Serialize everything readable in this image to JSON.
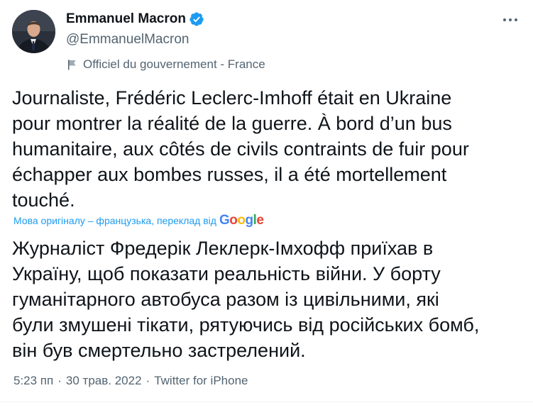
{
  "author": {
    "name": "Emmanuel Macron",
    "handle": "@EmmanuelMacron",
    "verified": true,
    "label": "Officiel du gouvernement - France"
  },
  "tweet": {
    "text": "Journaliste, Frédéric Leclerc-Imhoff était en Ukraine\npour montrer la réalité de la guerre. À bord d’un bus\nhumanitaire, aux côtés de civils contraints de fuir pour\néchapper aux bombes russes, il a été mortellement\ntouché.",
    "translation_note": "Мова оригіналу – французька, переклад від",
    "translation_provider": "Google",
    "translated_text": "Журналіст Фредерік Леклерк-Імхофф приїхав в\nУкраїну, щоб показати реальність війни. У борту\nгуманітарного автобуса разом із цивільними, які\nбули змушені тікати, рятуючись від російських бомб,\nвін був смертельно застрелений."
  },
  "meta": {
    "time": "5:23 пп",
    "separator": "·",
    "date": "30 трав. 2022",
    "source": "Twitter for iPhone"
  },
  "icons": {
    "verified": "verified-badge-icon",
    "label": "flag-icon",
    "more": "more-options-icon"
  },
  "colors": {
    "accent": "#1d9bf0",
    "text": "#0f1419",
    "secondary": "#536471"
  }
}
